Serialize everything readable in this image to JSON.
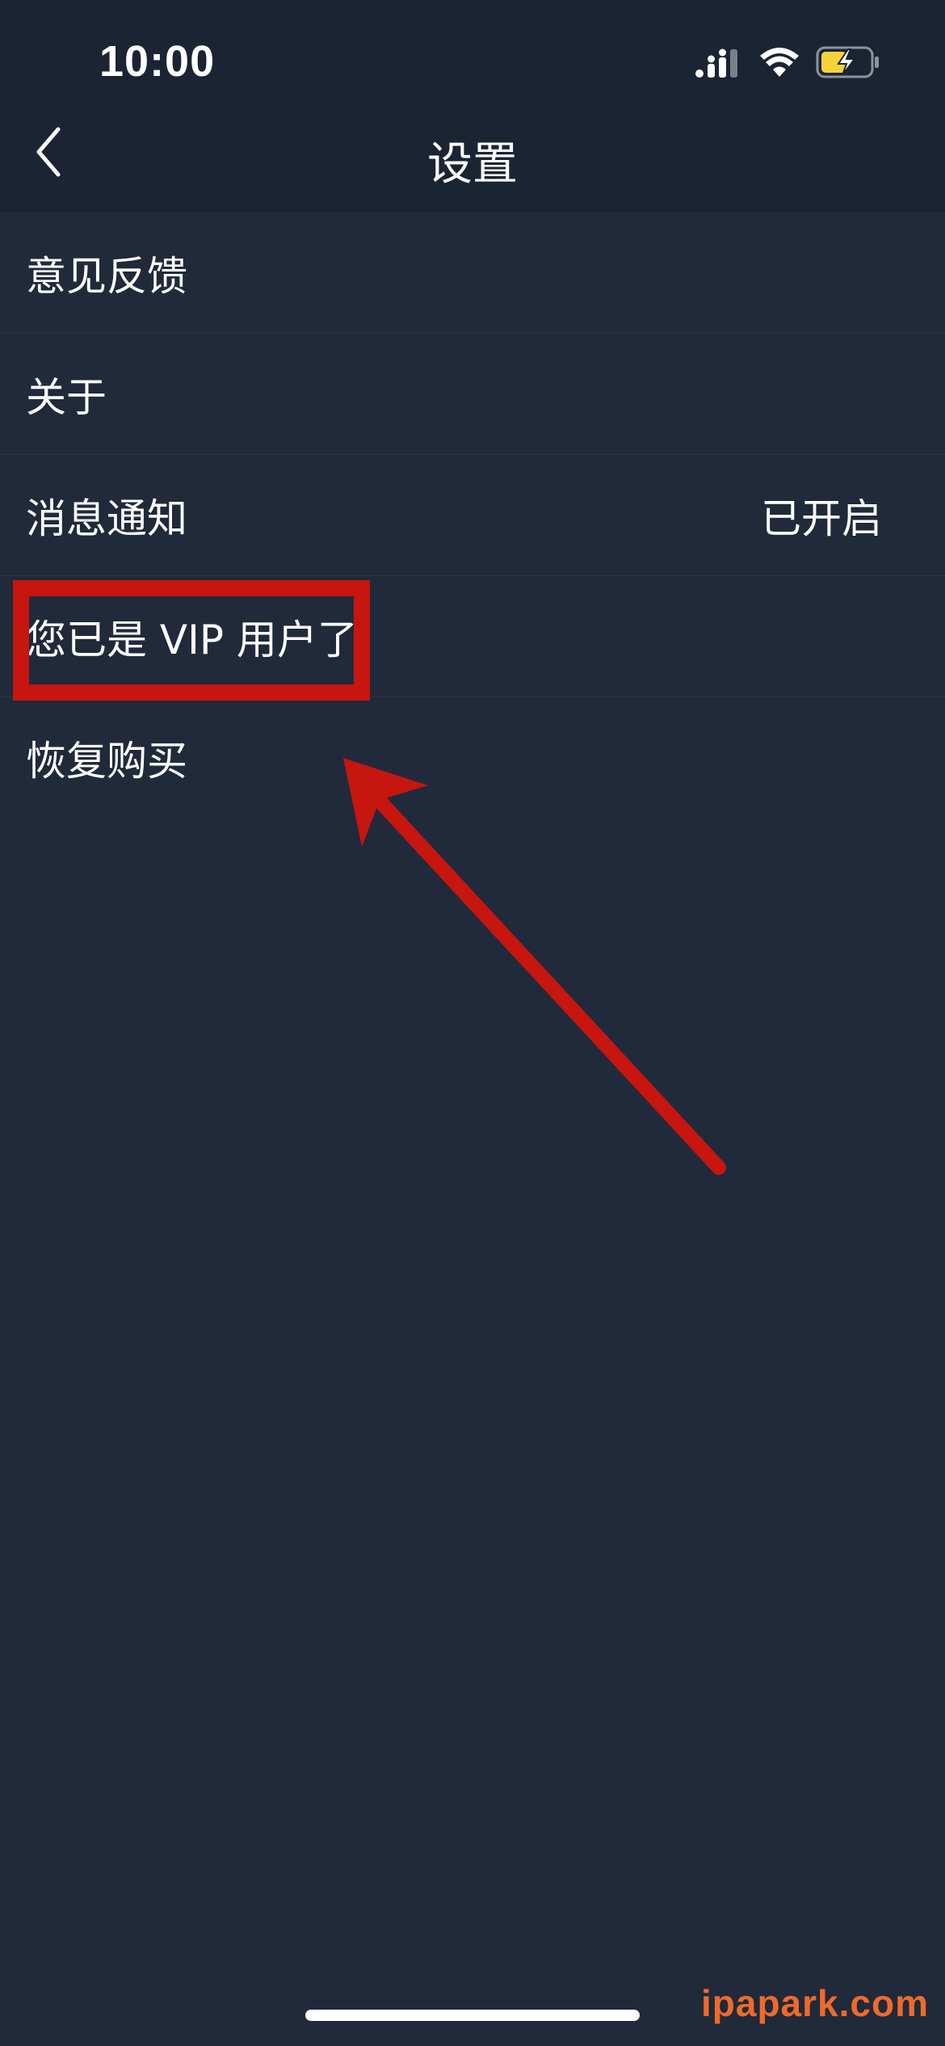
{
  "status_bar": {
    "time": "10:00",
    "icons": [
      "signal-icon",
      "wifi-icon",
      "battery-charging-icon"
    ],
    "battery_color": "#f5d33b"
  },
  "nav": {
    "title": "设置",
    "back_icon": "chevron-left-icon"
  },
  "settings": {
    "items": [
      {
        "label": "意见反馈",
        "value": ""
      },
      {
        "label": "关于",
        "value": ""
      },
      {
        "label": "消息通知",
        "value": "已开启"
      },
      {
        "label": "您已是 VIP 用户了",
        "value": ""
      },
      {
        "label": "恢复购买",
        "value": ""
      }
    ]
  },
  "annotation": {
    "color": "#c6160f"
  },
  "watermark": "ipapark.com",
  "colors": {
    "background": "#202a3b",
    "header": "#1b2433",
    "watermark": "#ee6a2c"
  }
}
